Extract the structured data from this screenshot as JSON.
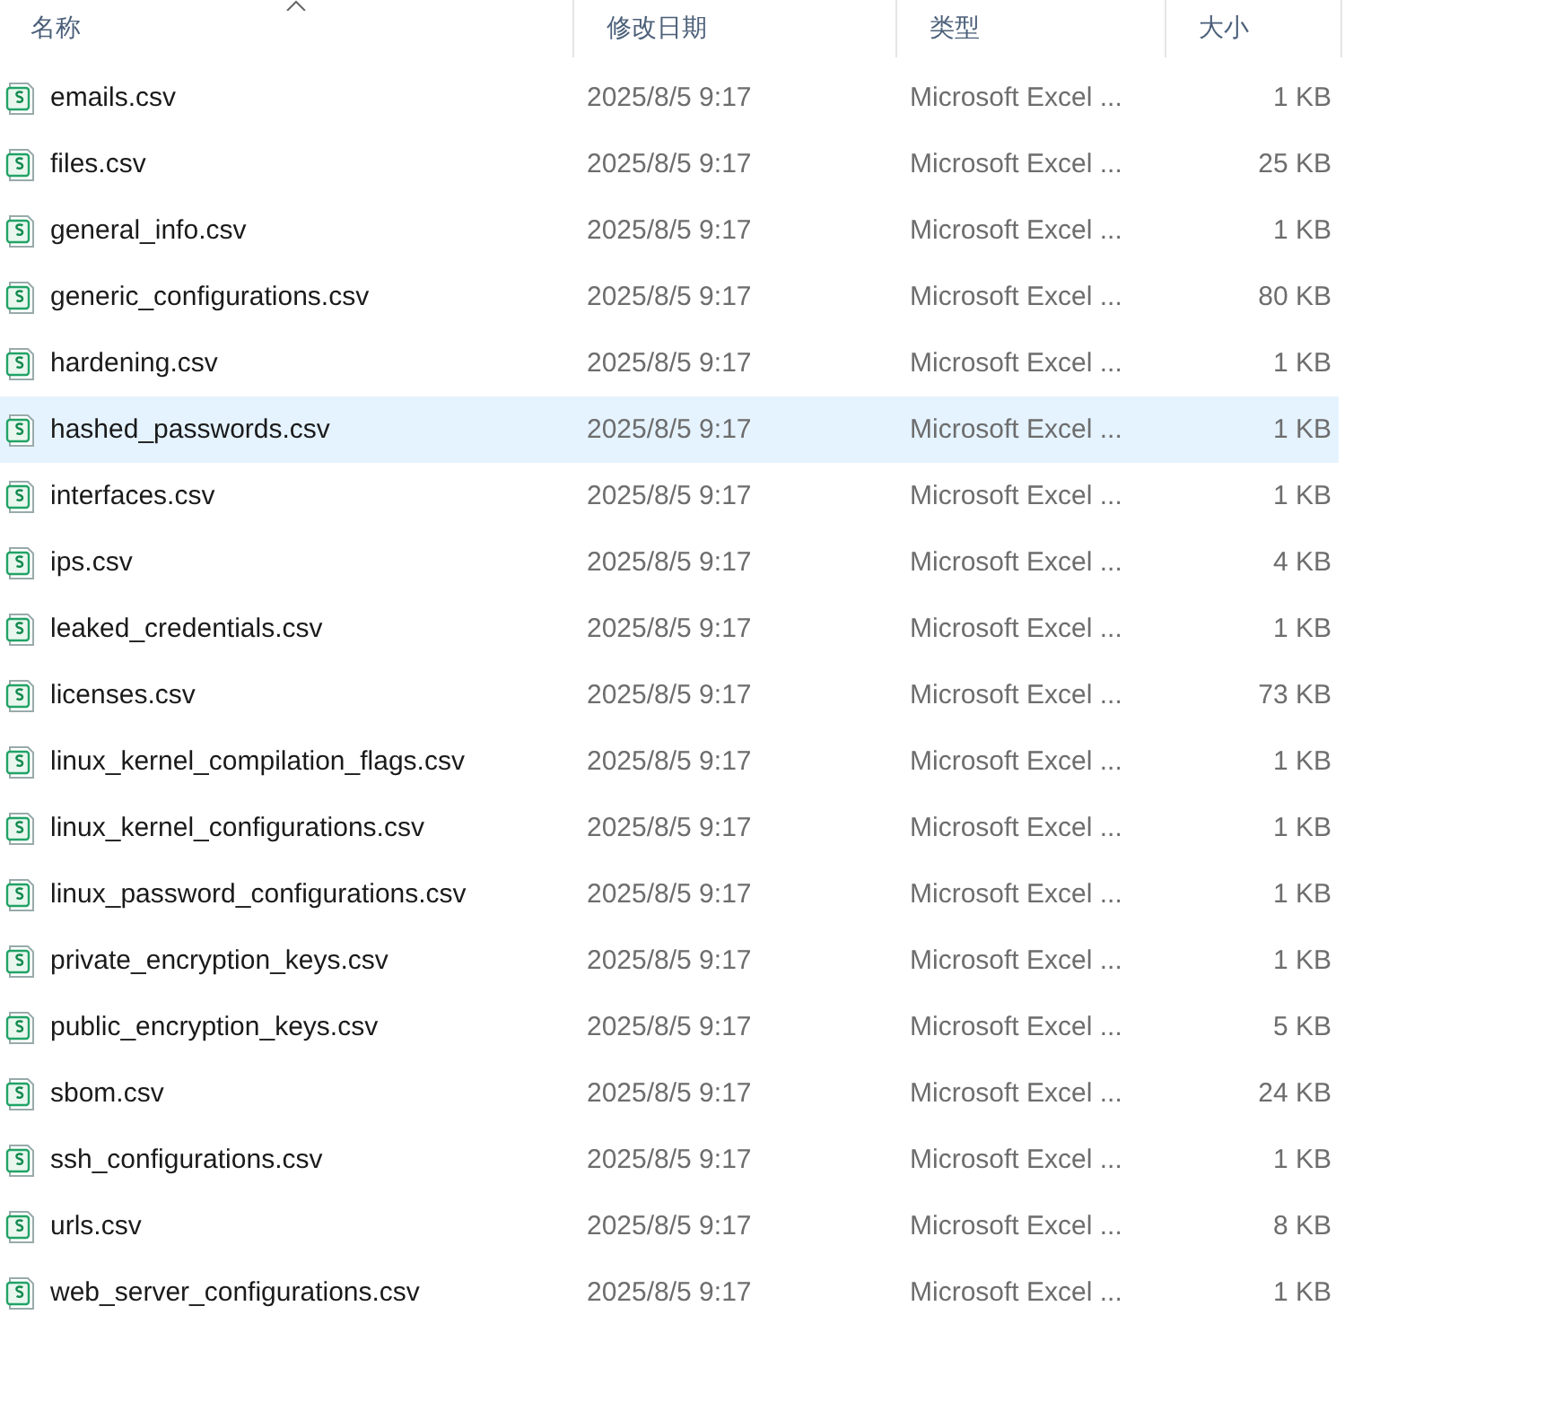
{
  "columns": [
    {
      "label": "名称",
      "sorted": true
    },
    {
      "label": "修改日期",
      "sorted": false
    },
    {
      "label": "类型",
      "sorted": false
    },
    {
      "label": "大小",
      "sorted": false
    }
  ],
  "rows": [
    {
      "name": "emails.csv",
      "date": "2025/8/5 9:17",
      "type": "Microsoft Excel ...",
      "size": "1 KB",
      "selected": false
    },
    {
      "name": "files.csv",
      "date": "2025/8/5 9:17",
      "type": "Microsoft Excel ...",
      "size": "25 KB",
      "selected": false
    },
    {
      "name": "general_info.csv",
      "date": "2025/8/5 9:17",
      "type": "Microsoft Excel ...",
      "size": "1 KB",
      "selected": false
    },
    {
      "name": "generic_configurations.csv",
      "date": "2025/8/5 9:17",
      "type": "Microsoft Excel ...",
      "size": "80 KB",
      "selected": false
    },
    {
      "name": "hardening.csv",
      "date": "2025/8/5 9:17",
      "type": "Microsoft Excel ...",
      "size": "1 KB",
      "selected": false
    },
    {
      "name": "hashed_passwords.csv",
      "date": "2025/8/5 9:17",
      "type": "Microsoft Excel ...",
      "size": "1 KB",
      "selected": true
    },
    {
      "name": "interfaces.csv",
      "date": "2025/8/5 9:17",
      "type": "Microsoft Excel ...",
      "size": "1 KB",
      "selected": false
    },
    {
      "name": "ips.csv",
      "date": "2025/8/5 9:17",
      "type": "Microsoft Excel ...",
      "size": "4 KB",
      "selected": false
    },
    {
      "name": "leaked_credentials.csv",
      "date": "2025/8/5 9:17",
      "type": "Microsoft Excel ...",
      "size": "1 KB",
      "selected": false
    },
    {
      "name": "licenses.csv",
      "date": "2025/8/5 9:17",
      "type": "Microsoft Excel ...",
      "size": "73 KB",
      "selected": false
    },
    {
      "name": "linux_kernel_compilation_flags.csv",
      "date": "2025/8/5 9:17",
      "type": "Microsoft Excel ...",
      "size": "1 KB",
      "selected": false
    },
    {
      "name": "linux_kernel_configurations.csv",
      "date": "2025/8/5 9:17",
      "type": "Microsoft Excel ...",
      "size": "1 KB",
      "selected": false
    },
    {
      "name": "linux_password_configurations.csv",
      "date": "2025/8/5 9:17",
      "type": "Microsoft Excel ...",
      "size": "1 KB",
      "selected": false
    },
    {
      "name": "private_encryption_keys.csv",
      "date": "2025/8/5 9:17",
      "type": "Microsoft Excel ...",
      "size": "1 KB",
      "selected": false
    },
    {
      "name": "public_encryption_keys.csv",
      "date": "2025/8/5 9:17",
      "type": "Microsoft Excel ...",
      "size": "5 KB",
      "selected": false
    },
    {
      "name": "sbom.csv",
      "date": "2025/8/5 9:17",
      "type": "Microsoft Excel ...",
      "size": "24 KB",
      "selected": false
    },
    {
      "name": "ssh_configurations.csv",
      "date": "2025/8/5 9:17",
      "type": "Microsoft Excel ...",
      "size": "1 KB",
      "selected": false
    },
    {
      "name": "urls.csv",
      "date": "2025/8/5 9:17",
      "type": "Microsoft Excel ...",
      "size": "8 KB",
      "selected": false
    },
    {
      "name": "web_server_configurations.csv",
      "date": "2025/8/5 9:17",
      "type": "Microsoft Excel ...",
      "size": "1 KB",
      "selected": false
    }
  ]
}
